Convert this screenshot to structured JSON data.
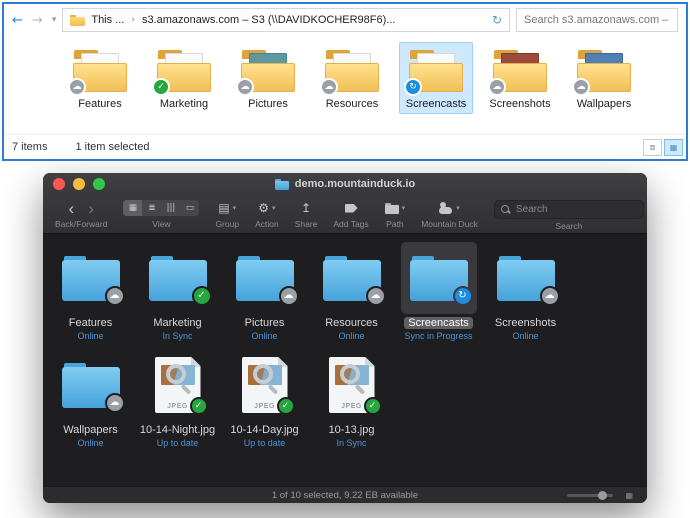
{
  "icons": {
    "back_arrow": "←",
    "forward_arrow": "→",
    "caret_down": "▾",
    "refresh": "↻",
    "crumb_separator": "›",
    "chevron_left": "‹",
    "chevron_right": "›",
    "view_icons": "▦",
    "view_list": "≣",
    "view_columns": "|||",
    "view_gallery": "▭",
    "group": "▤",
    "gear": "⚙",
    "share": "↥",
    "cloud": "☁",
    "check": "✓",
    "sync": "↻",
    "details_view": "≣",
    "thumbnails_view": "▦",
    "grid_small": "▦"
  },
  "explorer": {
    "breadcrumb": {
      "root": "This ...",
      "path": "s3.amazonaws.com – S3 (\\\\DAVIDKOCHER98F6)..."
    },
    "search": {
      "placeholder": "Search s3.amazonaws.com – ..."
    },
    "items": [
      {
        "name": "Features",
        "badge": "cloud"
      },
      {
        "name": "Marketing",
        "badge": "check"
      },
      {
        "name": "Pictures",
        "badge": "cloud"
      },
      {
        "name": "Resources",
        "badge": "cloud"
      },
      {
        "name": "Screencasts",
        "badge": "sync",
        "selected": true
      },
      {
        "name": "Screenshots",
        "badge": "cloud"
      },
      {
        "name": "Wallpapers",
        "badge": "cloud"
      }
    ],
    "statusbar": {
      "items_count": "7 items",
      "selection": "1 item selected"
    }
  },
  "finder": {
    "title": "demo.mountainduck.io",
    "toolbar": {
      "back_forward_label": "Back/Forward",
      "view_label": "View",
      "group_label": "Group",
      "action_label": "Action",
      "share_label": "Share",
      "add_tags_label": "Add Tags",
      "path_label": "Path",
      "mountain_duck_label": "Mountain Duck",
      "search_label": "Search",
      "search_placeholder": "Search"
    },
    "jpeg_label": "JPEG",
    "items": [
      {
        "name": "Features",
        "status": "Online",
        "type": "folder",
        "badge": "cloud"
      },
      {
        "name": "Marketing",
        "status": "In Sync",
        "type": "folder",
        "badge": "check"
      },
      {
        "name": "Pictures",
        "status": "Online",
        "type": "folder",
        "badge": "cloud"
      },
      {
        "name": "Resources",
        "status": "Online",
        "type": "folder",
        "badge": "cloud"
      },
      {
        "name": "Screencasts",
        "status": "Sync in Progress",
        "type": "folder",
        "badge": "sync",
        "selected": true
      },
      {
        "name": "Screenshots",
        "status": "Online",
        "type": "folder",
        "badge": "cloud"
      },
      {
        "name": "Wallpapers",
        "status": "Online",
        "type": "folder",
        "badge": "cloud"
      },
      {
        "name": "10-14-Night.jpg",
        "status": "Up to date",
        "type": "jpeg",
        "badge": "check"
      },
      {
        "name": "10-14-Day.jpg",
        "status": "Up to date",
        "type": "jpeg",
        "badge": "check"
      },
      {
        "name": "10-13.jpg",
        "status": "In Sync",
        "type": "jpeg",
        "badge": "check"
      }
    ],
    "statusbar": {
      "summary": "1 of 10 selected, 9.22 EB available"
    },
    "colors": {
      "status_text": "#4d94d8",
      "folder_blue": "#49a4da",
      "selection_bg": "#3a3a3e"
    }
  }
}
